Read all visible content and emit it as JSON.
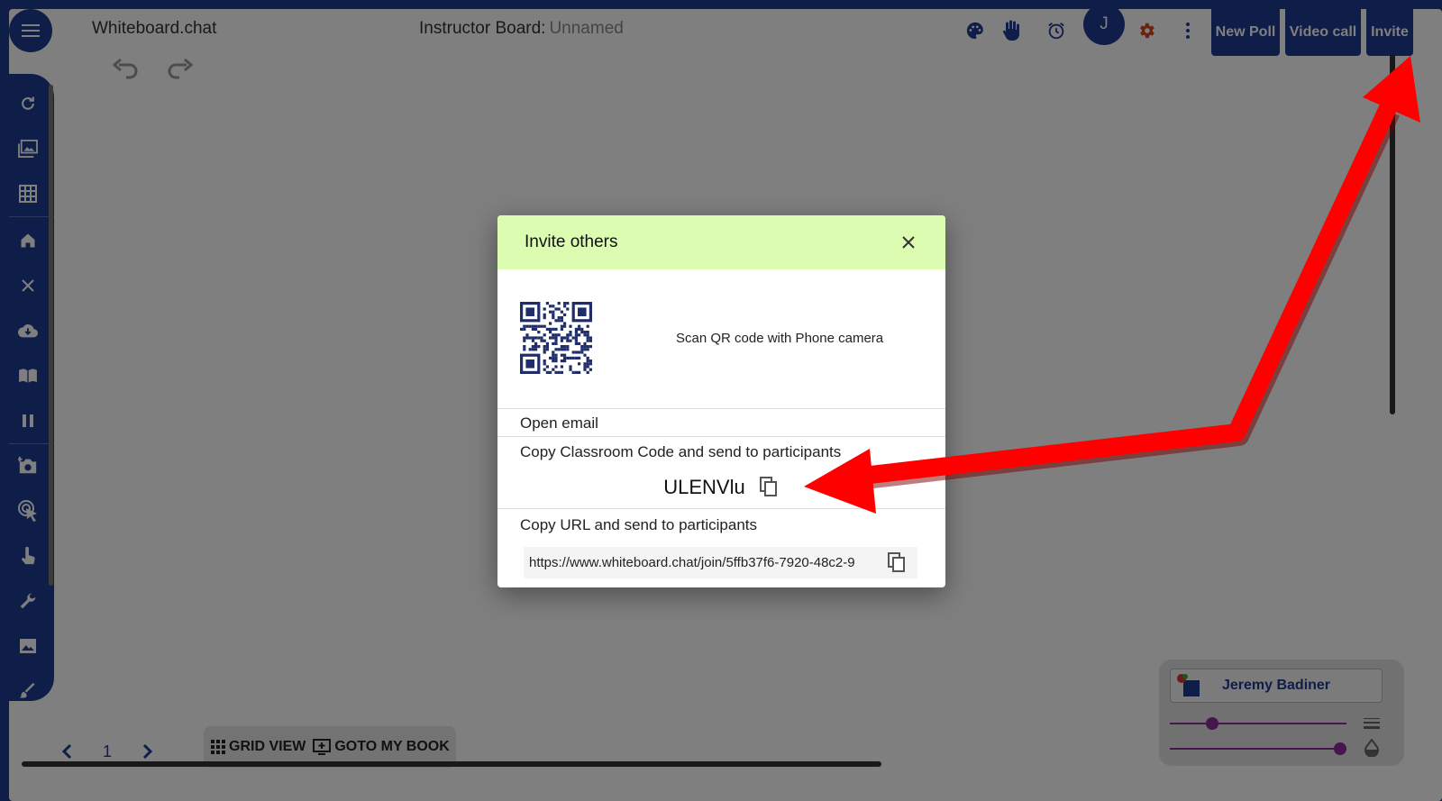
{
  "app": {
    "title": "Whiteboard.chat",
    "board_label": "Instructor Board:",
    "board_name": "Unnamed",
    "avatar_letter": "J",
    "buttons": {
      "new_poll": "New Poll",
      "video_call": "Video call",
      "invite": "Invite"
    }
  },
  "top_icons": [
    "palette-icon",
    "hand-icon",
    "alarm-icon",
    "gear-icon",
    "more-vert-icon"
  ],
  "sidebar_icons": [
    "refresh-icon",
    "images-icon",
    "grid-icon",
    "home-icon",
    "close-icon",
    "cloud-download-icon",
    "book-icon",
    "pause-icon",
    "camera-add-icon",
    "pointer-icon",
    "touch-icon",
    "wrench-icon",
    "image-icon",
    "brush-icon"
  ],
  "pager": {
    "page": "1"
  },
  "view": {
    "grid_view": "GRID VIEW",
    "goto_book": "GOTO MY BOOK"
  },
  "user": {
    "name": "Jeremy Badiner",
    "size_value": 0.22,
    "opacity_value": 1.0
  },
  "dialog": {
    "title": "Invite others",
    "qr_text": "Scan QR code with Phone camera",
    "open_email": "Open email",
    "code_label": "Copy Classroom Code and send to participants",
    "code": "ULENVlu",
    "url_label": "Copy URL and send to participants",
    "url": "https://www.whiteboard.chat/join/5ffb37f6-7920-48c2-9"
  },
  "colors": {
    "brand": "#1f3a93",
    "dialog_header": "#dcfdb1",
    "arrow": "#ff0000",
    "settings": "#d2471c",
    "slider": "#8a2f98"
  }
}
